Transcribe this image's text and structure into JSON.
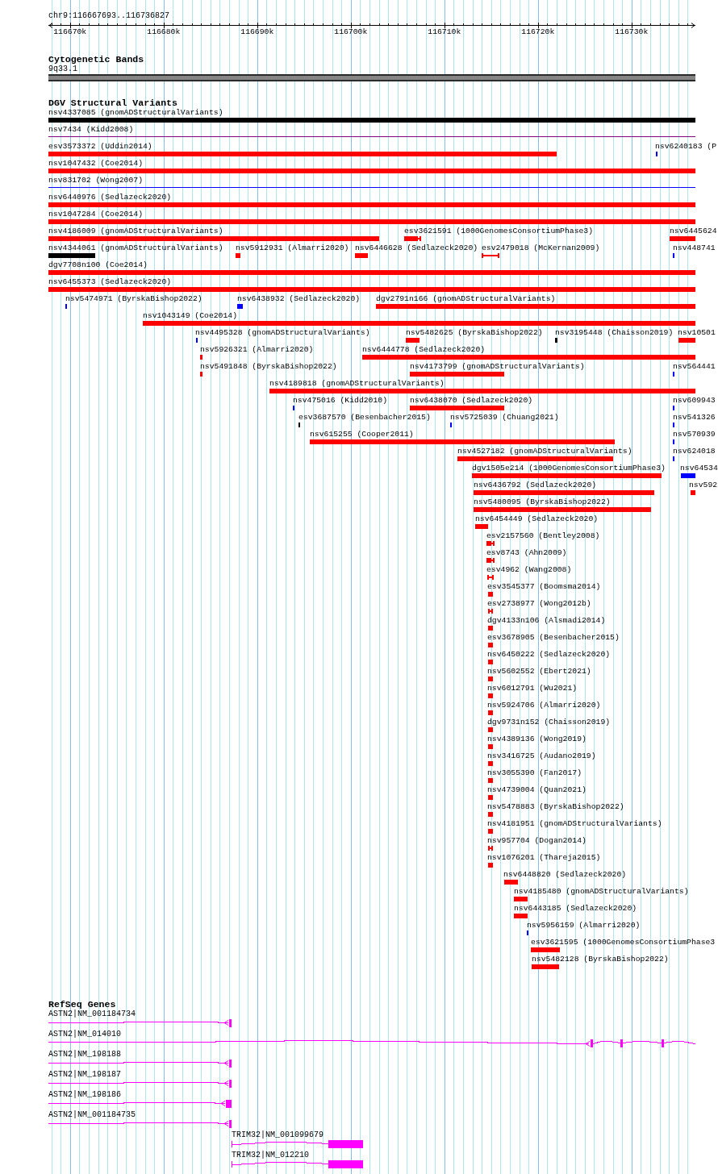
{
  "ruler": {
    "region": "chr9:116667693..116736827",
    "ticks": [
      "116670k",
      "116680k",
      "116690k",
      "116700k",
      "116710k",
      "116720k",
      "116730k"
    ]
  },
  "cytogenetic_bands": {
    "title": "Cytogenetic Bands",
    "bands": [
      {
        "label": "9q33.1"
      }
    ]
  },
  "dgv_structural_variants": {
    "title": "DGV Structural Variants",
    "features": [
      {
        "label": "nsv4337085 (gnomADStructuralVariants)",
        "kind": "bar",
        "color": "#000000"
      },
      {
        "label": "nsv7434 (Kidd2008)",
        "kind": "line",
        "color": "#800080"
      },
      {
        "label": "esv3573372 (Uddin2014)",
        "kind": "bar",
        "color": "#ff0000"
      },
      {
        "label": "nsv6240183 (P",
        "kind": "bar",
        "color": "#0000ff"
      },
      {
        "label": "nsv1047432 (Coe2014)",
        "kind": "bar",
        "color": "#ff0000"
      },
      {
        "label": "nsv831702 (Wong2007)",
        "kind": "line",
        "color": "#0000ff"
      },
      {
        "label": "nsv6440976 (Sedlazeck2020)",
        "kind": "bar",
        "color": "#ff0000"
      },
      {
        "label": "nsv1047284 (Coe2014)",
        "kind": "bar",
        "color": "#ff0000"
      },
      {
        "label": "nsv4186009 (gnomADStructuralVariants)",
        "kind": "bar",
        "color": "#ff0000"
      },
      {
        "label": "esv3621591 (1000GenomesConsortiumPhase3)",
        "kind": "capped",
        "color": "#ff0000"
      },
      {
        "label": "nsv6445624",
        "kind": "bar",
        "color": "#ff0000"
      },
      {
        "label": "nsv4344061 (gnomADStructuralVariants)",
        "kind": "bar",
        "color": "#000000"
      },
      {
        "label": "nsv5912931 (Almarri2020)",
        "kind": "bar",
        "color": "#ff0000"
      },
      {
        "label": "nsv6446628 (Sedlazeck2020)",
        "kind": "bar",
        "color": "#ff0000"
      },
      {
        "label": "esv2479018 (McKernan2009)",
        "kind": "bracket",
        "color": "#ff0000"
      },
      {
        "label": "nsv448741",
        "kind": "bar",
        "color": "#0000ff"
      },
      {
        "label": "dgv7708n100 (Coe2014)",
        "kind": "bar",
        "color": "#ff0000"
      },
      {
        "label": "nsv6455373 (Sedlazeck2020)",
        "kind": "bar",
        "color": "#ff0000"
      },
      {
        "label": "nsv5474971 (ByrskaBishop2022)",
        "kind": "bar",
        "color": "#0000ff"
      },
      {
        "label": "nsv6438932 (Sedlazeck2020)",
        "kind": "bar",
        "color": "#0000ff"
      },
      {
        "label": "dgv2791n166 (gnomADStructuralVariants)",
        "kind": "bar",
        "color": "#ff0000"
      },
      {
        "label": "nsv1043149 (Coe2014)",
        "kind": "bar",
        "color": "#ff0000"
      },
      {
        "label": "nsv4495328 (gnomADStructuralVariants)",
        "kind": "bar",
        "color": "#0000ff"
      },
      {
        "label": "nsv5482625 (ByrskaBishop2022)",
        "kind": "bar",
        "color": "#ff0000"
      },
      {
        "label": "nsv3195448 (Chaisson2019)",
        "kind": "bar",
        "color": "#000000"
      },
      {
        "label": "nsv10501",
        "kind": "bar",
        "color": "#ff0000"
      },
      {
        "label": "nsv5926321 (Almarri2020)",
        "kind": "bar",
        "color": "#ff0000"
      },
      {
        "label": "nsv6444778 (Sedlazeck2020)",
        "kind": "bar",
        "color": "#ff0000"
      },
      {
        "label": "nsv5491848 (ByrskaBishop2022)",
        "kind": "bar",
        "color": "#ff0000"
      },
      {
        "label": "nsv4173799 (gnomADStructuralVariants)",
        "kind": "bar",
        "color": "#ff0000"
      },
      {
        "label": "nsv564441",
        "kind": "bar",
        "color": "#0000ff"
      },
      {
        "label": "nsv4189818 (gnomADStructuralVariants)",
        "kind": "bar",
        "color": "#ff0000"
      },
      {
        "label": "nsv475016 (Kidd2010)",
        "kind": "bar",
        "color": "#0000ff"
      },
      {
        "label": "nsv6438070 (Sedlazeck2020)",
        "kind": "bar",
        "color": "#ff0000"
      },
      {
        "label": "nsv609943",
        "kind": "bar",
        "color": "#0000ff"
      },
      {
        "label": "esv3687570 (Besenbacher2015)",
        "kind": "bar",
        "color": "#000000"
      },
      {
        "label": "nsv5725039 (Chuang2021)",
        "kind": "bar",
        "color": "#0000ff"
      },
      {
        "label": "nsv541326",
        "kind": "bar",
        "color": "#0000ff"
      },
      {
        "label": "nsv615255 (Cooper2011)",
        "kind": "bar",
        "color": "#ff0000"
      },
      {
        "label": "nsv570939",
        "kind": "bar",
        "color": "#0000ff"
      },
      {
        "label": "nsv4527182 (gnomADStructuralVariants)",
        "kind": "bar",
        "color": "#ff0000"
      },
      {
        "label": "nsv624018",
        "kind": "bar",
        "color": "#0000ff"
      },
      {
        "label": "dgv1505e214 (1000GenomesConsortiumPhase3)",
        "kind": "bar",
        "color": "#ff0000"
      },
      {
        "label": "nsv64534",
        "kind": "bar",
        "color": "#0000ff"
      },
      {
        "label": "nsv6436792 (Sedlazeck2020)",
        "kind": "bar",
        "color": "#ff0000"
      },
      {
        "label": "nsv592",
        "kind": "bar",
        "color": "#ff0000"
      },
      {
        "label": "nsv5480095 (ByrskaBishop2022)",
        "kind": "bar",
        "color": "#ff0000"
      },
      {
        "label": "nsv6454449 (Sedlazeck2020)",
        "kind": "bar",
        "color": "#ff0000"
      },
      {
        "label": "esv2157560 (Bentley2008)",
        "kind": "capped",
        "color": "#ff0000"
      },
      {
        "label": "esv8743 (Ahn2009)",
        "kind": "capped",
        "color": "#ff0000"
      },
      {
        "label": "esv4962 (Wang2008)",
        "kind": "bracket",
        "color": "#ff0000"
      },
      {
        "label": "esv3545377 (Boomsma2014)",
        "kind": "bar",
        "color": "#ff0000"
      },
      {
        "label": "esv2738977 (Wong2012b)",
        "kind": "bracket",
        "color": "#ff0000"
      },
      {
        "label": "dgv4133n106 (Alsmadi2014)",
        "kind": "bar",
        "color": "#ff0000"
      },
      {
        "label": "esv3678905 (Besenbacher2015)",
        "kind": "bar",
        "color": "#ff0000"
      },
      {
        "label": "nsv6450222 (Sedlazeck2020)",
        "kind": "bar",
        "color": "#ff0000"
      },
      {
        "label": "nsv5602552 (Ebert2021)",
        "kind": "bar",
        "color": "#ff0000"
      },
      {
        "label": "nsv6012791 (Wu2021)",
        "kind": "bar",
        "color": "#ff0000"
      },
      {
        "label": "nsv5924706 (Almarri2020)",
        "kind": "bar",
        "color": "#ff0000"
      },
      {
        "label": "dgv9731n152 (Chaisson2019)",
        "kind": "bar",
        "color": "#ff0000"
      },
      {
        "label": "nsv4389136 (Wong2019)",
        "kind": "bar",
        "color": "#ff0000"
      },
      {
        "label": "nsv3416725 (Audano2019)",
        "kind": "bar",
        "color": "#ff0000"
      },
      {
        "label": "nsv3055390 (Fan2017)",
        "kind": "bar",
        "color": "#ff0000"
      },
      {
        "label": "nsv4739004 (Quan2021)",
        "kind": "bar",
        "color": "#ff0000"
      },
      {
        "label": "nsv5478883 (ByrskaBishop2022)",
        "kind": "bar",
        "color": "#ff0000"
      },
      {
        "label": "nsv4181951 (gnomADStructuralVariants)",
        "kind": "bar",
        "color": "#ff0000"
      },
      {
        "label": "nsv957704 (Dogan2014)",
        "kind": "bracket",
        "color": "#ff0000"
      },
      {
        "label": "nsv1076201 (Thareja2015)",
        "kind": "bar",
        "color": "#ff0000"
      },
      {
        "label": "nsv6448820 (Sedlazeck2020)",
        "kind": "bar",
        "color": "#ff0000"
      },
      {
        "label": "nsv4185480 (gnomADStructuralVariants)",
        "kind": "bar",
        "color": "#ff0000"
      },
      {
        "label": "nsv6443185 (Sedlazeck2020)",
        "kind": "bar",
        "color": "#ff0000"
      },
      {
        "label": "nsv5956159 (Almarri2020)",
        "kind": "bar",
        "color": "#0000ff"
      },
      {
        "label": "esv3621595 (1000GenomesConsortiumPhase3",
        "kind": "bar",
        "color": "#ff0000"
      },
      {
        "label": "nsv5482128 (ByrskaBishop2022)",
        "kind": "bar",
        "color": "#ff0000"
      }
    ]
  },
  "refseq_genes": {
    "title": "RefSeq Genes",
    "genes": [
      {
        "label": "ASTN2|NM_001184734"
      },
      {
        "label": "ASTN2|NM_014010"
      },
      {
        "label": "ASTN2|NM_198188"
      },
      {
        "label": "ASTN2|NM_198187"
      },
      {
        "label": "ASTN2|NM_198186"
      },
      {
        "label": "ASTN2|NM_001184735"
      },
      {
        "label": "TRIM32|NM_001099679"
      },
      {
        "label": "TRIM32|NM_012210"
      }
    ]
  }
}
